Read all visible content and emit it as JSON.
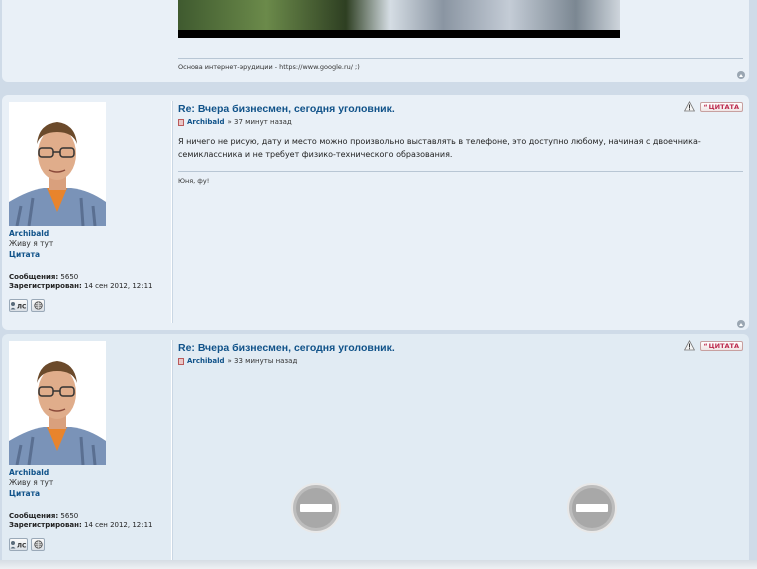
{
  "post0": {
    "signature": "Основа интернет-эрудиции - https://www.google.ru/ ;)"
  },
  "posts": [
    {
      "title": "Re: Вчера бизнесмен, сегодня уголовник.",
      "author": "Archibald",
      "time": "» 37 минут назад",
      "content": "Я ничего не рисую, дату и место можно произвольно выставлять в телефоне, это доступно любому, начиная с двоечника-семиклассника и не требует физико-технического образования.",
      "signature": "Юня, фу!",
      "quote_label": "ЦИТАТА"
    },
    {
      "title": "Re: Вчера бизнесмен, сегодня уголовник.",
      "author": "Archibald",
      "time": "» 33 минуты назад",
      "quote_label": "ЦИТАТА"
    }
  ],
  "profile": {
    "name": "Archibald",
    "location": "Живу я тут",
    "rank": "Цитата",
    "posts_label": "Сообщения:",
    "posts_value": "5650",
    "registered_label": "Зарегистрирован:",
    "registered_value": "14 сен 2012, 12:11",
    "pm_label": "ЛС"
  },
  "colors": {
    "link": "#105289",
    "quote": "#bc2a4d",
    "post_bg": "#e9f0f7",
    "page_bg": "#cfdbe8"
  },
  "icons": {
    "report": "warning-triangle-icon",
    "post": "post-file-icon",
    "top": "back-to-top-icon",
    "www": "globe-icon",
    "blocked": "no-entry-icon"
  }
}
